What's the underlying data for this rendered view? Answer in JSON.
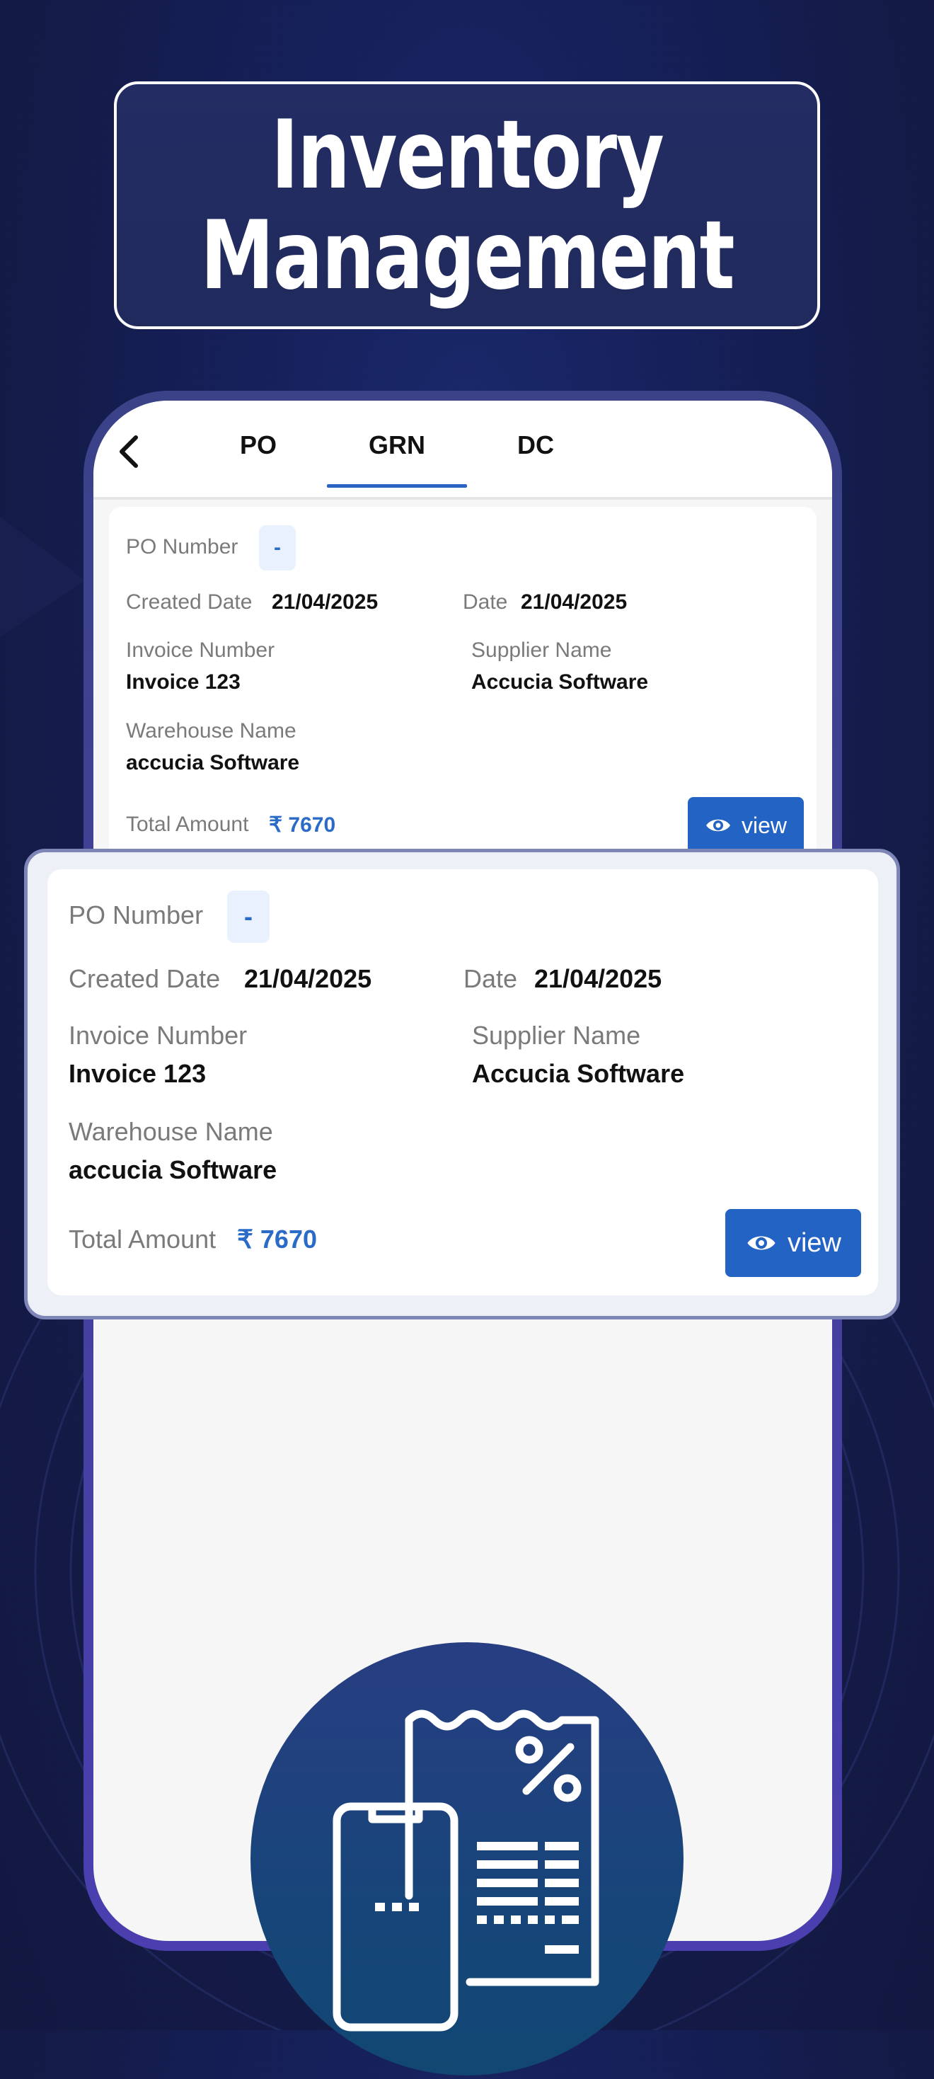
{
  "banner": {
    "title": "Inventory\nManagement"
  },
  "tabs": [
    {
      "label": "PO",
      "active": false
    },
    {
      "label": "GRN",
      "active": true
    },
    {
      "label": "DC",
      "active": false
    }
  ],
  "grn_card": {
    "po_number_label": "PO Number",
    "po_number_value": "-",
    "created_date_label": "Created Date",
    "created_date_value": "21/04/2025",
    "date_label": "Date",
    "date_value": "21/04/2025",
    "invoice_number_label": "Invoice Number",
    "invoice_number_value": "Invoice 123",
    "supplier_name_label": "Supplier Name",
    "supplier_name_value": "Accucia Software",
    "warehouse_name_label": "Warehouse Name",
    "warehouse_name_value": "accucia Software",
    "total_amount_label": "Total Amount",
    "total_amount_value": "₹ 7670",
    "view_button_label": "view"
  },
  "icons": {
    "back": "chevron-left-icon",
    "view": "eye-icon",
    "feature": "mobile-receipt-percent-icon"
  },
  "colors": {
    "background": "#141b47",
    "accent_blue": "#2363c4",
    "phone_frame": "#4b3fb0"
  }
}
